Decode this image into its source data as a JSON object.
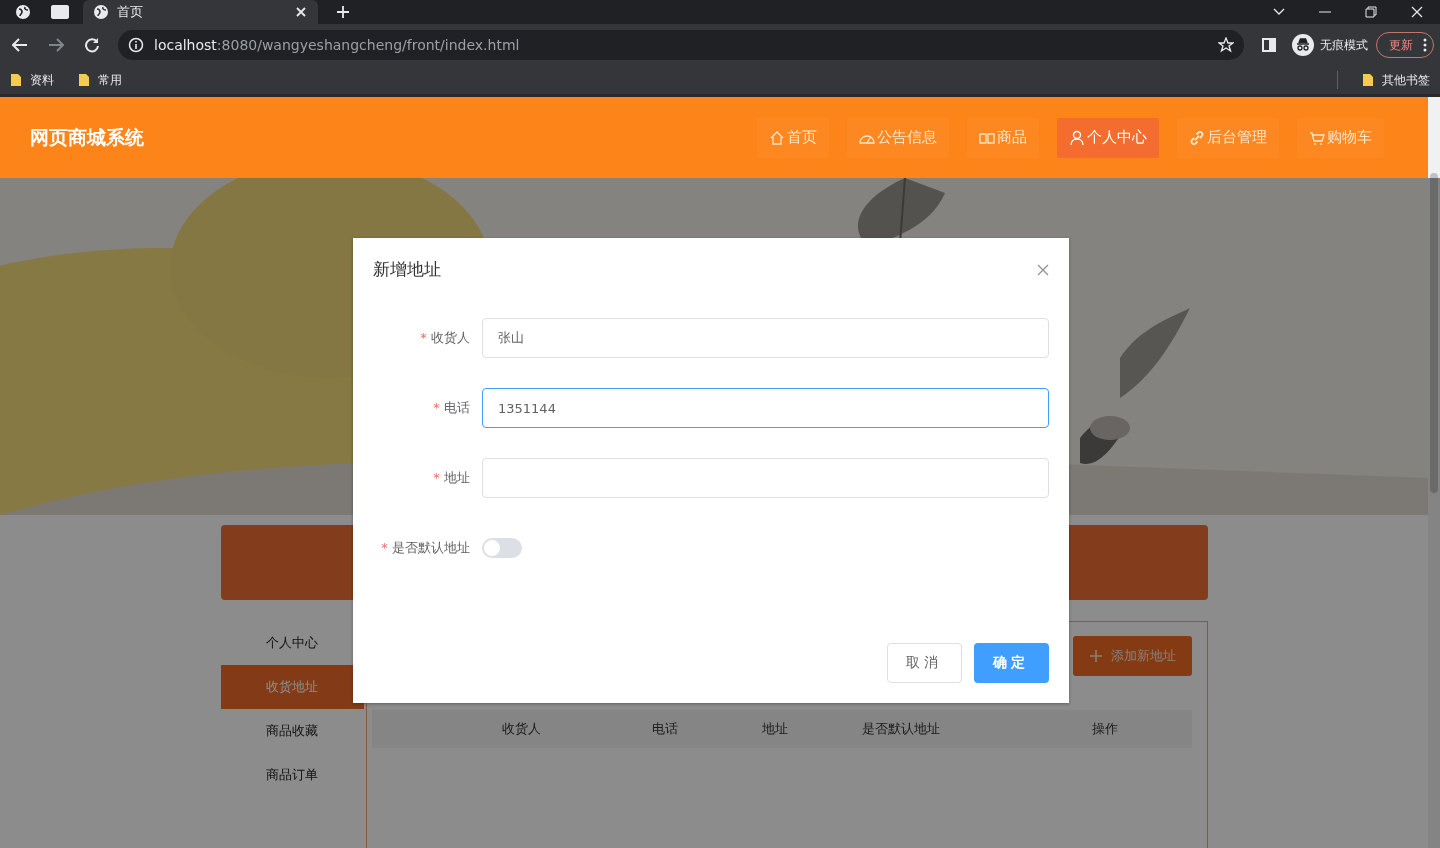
{
  "browser": {
    "tabs": [
      {
        "title": "首页",
        "selected": true
      }
    ],
    "url": {
      "host": "localhost",
      "rest": ":8080/wangyeshangcheng/front/index.html"
    },
    "profile": "无痕模式",
    "update_button": "更新",
    "bookmarks": [
      "资料",
      "常用"
    ],
    "other_bookmarks": "其他书签"
  },
  "header": {
    "logo": "网页商城系统",
    "nav": [
      {
        "label": "首页",
        "selected": false
      },
      {
        "label": "公告信息",
        "selected": false
      },
      {
        "label": "商品",
        "selected": false
      },
      {
        "label": "个人中心",
        "selected": true
      },
      {
        "label": "后台管理",
        "selected": false
      },
      {
        "label": "购物车",
        "selected": false
      }
    ]
  },
  "sidebar": {
    "items": [
      {
        "label": "个人中心",
        "selected": false
      },
      {
        "label": "收货地址",
        "selected": true
      },
      {
        "label": "商品收藏",
        "selected": false
      },
      {
        "label": "商品订单",
        "selected": false
      }
    ]
  },
  "address_panel": {
    "add_button": "添加新地址",
    "columns": [
      "收货人",
      "电话",
      "地址",
      "是否默认地址",
      "操作"
    ]
  },
  "dialog": {
    "title": "新增地址",
    "fields": [
      {
        "label": "收货人",
        "required_mark": "*",
        "kind": "text",
        "value": "张山",
        "focused": false
      },
      {
        "label": "电话",
        "required_mark": "*",
        "kind": "text",
        "value": "1351144",
        "focused": true
      },
      {
        "label": "地址",
        "required_mark": "*",
        "kind": "text",
        "focused": false
      },
      {
        "label": "是否默认地址",
        "required_mark": "*",
        "kind": "switch",
        "on": false
      }
    ],
    "buttons": [
      {
        "label": "取消",
        "kind": "default"
      },
      {
        "label": "确定",
        "kind": "primary"
      }
    ]
  }
}
